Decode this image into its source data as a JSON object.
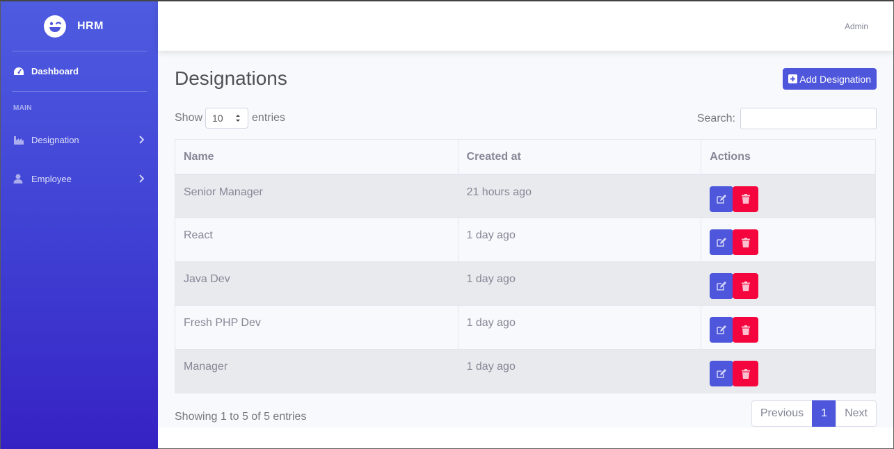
{
  "brand": {
    "name": "HRM"
  },
  "sidebar": {
    "dashboard_label": "Dashboard",
    "section_heading": "MAIN",
    "items": [
      {
        "label": "Designation",
        "icon": "industry-icon"
      },
      {
        "label": "Employee",
        "icon": "user-icon"
      }
    ]
  },
  "topbar": {
    "user_label": "Admin"
  },
  "page": {
    "title": "Designations",
    "add_button_label": "Add Designation",
    "show_label": "Show",
    "entries_label": "entries",
    "page_length": "10",
    "search_label": "Search:",
    "search_value": "",
    "search_placeholder": ""
  },
  "table": {
    "headers": {
      "name": "Name",
      "created": "Created at",
      "actions": "Actions"
    },
    "rows": [
      {
        "name": "Senior Manager",
        "created": "21 hours ago"
      },
      {
        "name": "React",
        "created": "1 day ago"
      },
      {
        "name": "Java Dev",
        "created": "1 day ago"
      },
      {
        "name": "Fresh PHP Dev",
        "created": "1 day ago"
      },
      {
        "name": "Manager",
        "created": "1 day ago"
      }
    ]
  },
  "footer": {
    "info": "Showing 1 to 5 of 5 entries",
    "previous_label": "Previous",
    "current_page": "1",
    "next_label": "Next"
  },
  "colors": {
    "sidebar_top": "#4e5ce0",
    "sidebar_bottom": "#3622c3",
    "primary": "#4e56dc",
    "danger": "#f5053d"
  }
}
